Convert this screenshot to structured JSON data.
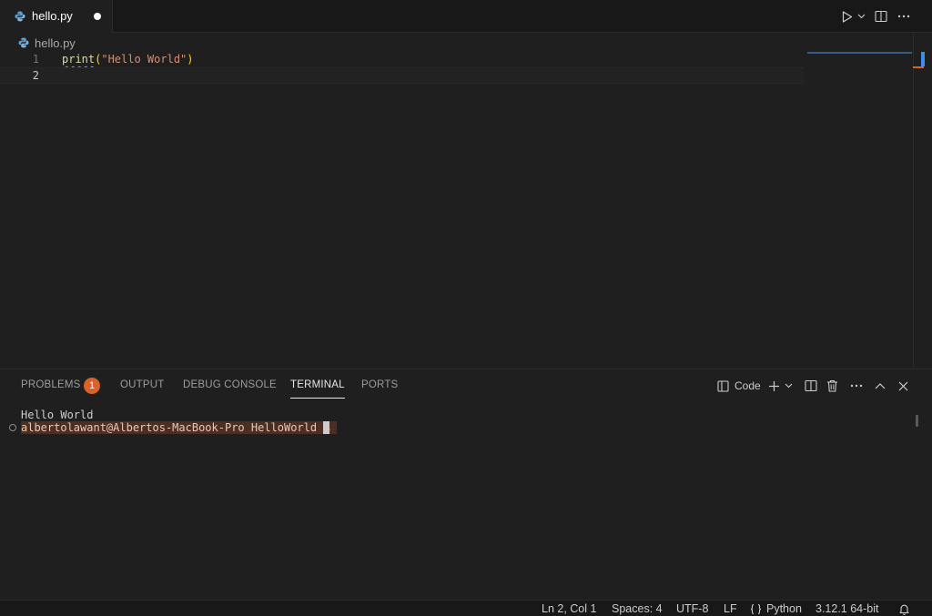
{
  "editor_tab": {
    "file_name": "hello.py",
    "modified": true
  },
  "breadcrumb": {
    "file_name": "hello.py"
  },
  "editor": {
    "lines": [
      {
        "number": "1",
        "fn": "print",
        "open": "(",
        "string": "\"Hello World\"",
        "close": ")"
      },
      {
        "number": "2"
      }
    ]
  },
  "panel": {
    "tabs": [
      "PROBLEMS",
      "OUTPUT",
      "DEBUG CONSOLE",
      "TERMINAL",
      "PORTS"
    ],
    "active_tab": "TERMINAL",
    "problems_count": "1",
    "terminal_profile": "Code",
    "terminal": {
      "output": "Hello World",
      "prompt": "albertolawant@Albertos-MacBook-Pro HelloWorld % "
    }
  },
  "status_bar": {
    "position": "Ln 2, Col 1",
    "indent": "Spaces: 4",
    "encoding": "UTF-8",
    "eol": "LF",
    "language": "Python",
    "interpreter": "3.12.1 64-bit"
  },
  "colors": {
    "background": "#1f1f1f",
    "badge": "#d9612a",
    "function": "#dcdcaa",
    "string": "#ce9178",
    "bracket": "#ffd700"
  },
  "icons": [
    "python-file-icon",
    "run-icon",
    "dropdown-chevron-icon",
    "split-editor-icon",
    "more-actions-icon",
    "terminal-profile-icon",
    "add-icon",
    "trash-icon",
    "maximize-chevron-up-icon",
    "close-icon",
    "python-braces-icon",
    "bell-icon"
  ]
}
